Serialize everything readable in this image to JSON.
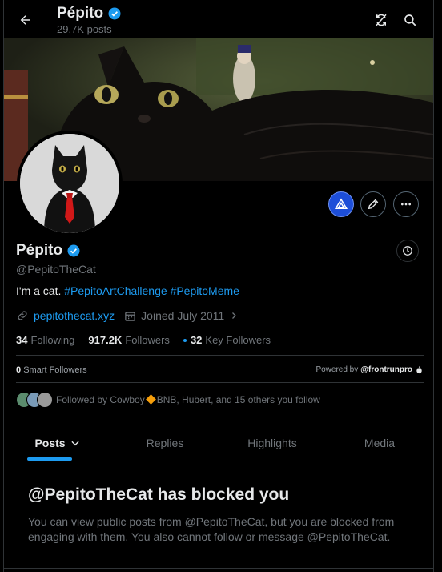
{
  "header": {
    "name": "Pépito",
    "post_count": "29.7K posts"
  },
  "profile": {
    "name": "Pépito",
    "handle": "@PepitoTheCat",
    "bio_text": "I'm a cat.",
    "bio_tags": [
      "#PepitoArtChallenge",
      "#PepitoMeme"
    ],
    "website": "pepitothecat.xyz",
    "joined": "Joined July 2011",
    "following_count": "34",
    "following_label": "Following",
    "followers_count": "917.2K",
    "followers_label": "Followers",
    "key_followers_count": "32",
    "key_followers_label": "Key Followers"
  },
  "smart_followers": {
    "count": "0",
    "label": "Smart Followers",
    "powered_by": "Powered by",
    "provider": "@frontrunpro"
  },
  "followed_by": {
    "prefix": "Followed by Cowboy",
    "suffix": "BNB, Hubert, and 15 others you follow"
  },
  "tabs": [
    {
      "label": "Posts",
      "active": true
    },
    {
      "label": "Replies",
      "active": false
    },
    {
      "label": "Highlights",
      "active": false
    },
    {
      "label": "Media",
      "active": false
    }
  ],
  "blocked": {
    "title": "@PepitoTheCat has blocked you",
    "message": "You can view public posts from @PepitoTheCat, but you are blocked from engaging with them. You also cannot follow or message @PepitoTheCat."
  },
  "colors": {
    "accent": "#1d9bf0",
    "background": "#000000",
    "text_primary": "#e7e9ea",
    "text_secondary": "#71767b",
    "divider": "#2f3336"
  },
  "icons": {
    "header": [
      "back-arrow-icon",
      "verified-badge-icon",
      "sync-icon",
      "search-icon"
    ],
    "actions": [
      "triangle-logo-icon",
      "pencil-icon",
      "more-icon",
      "history-clock-icon"
    ]
  }
}
